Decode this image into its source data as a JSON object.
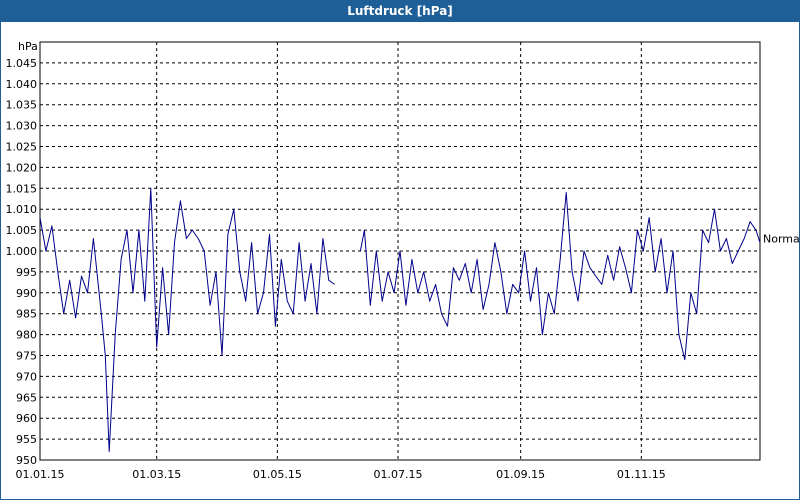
{
  "window": {
    "title": "Luftdruck [hPa]"
  },
  "chart_data": {
    "type": "line",
    "title": "Luftdruck [hPa]",
    "ylabel": "hPa",
    "ylim": [
      950,
      1050
    ],
    "y_ticks": [
      950,
      955,
      960,
      965,
      970,
      975,
      980,
      985,
      990,
      995,
      1000,
      1005,
      1010,
      1015,
      1020,
      1025,
      1030,
      1035,
      1040,
      1045
    ],
    "y_tick_labels": [
      "950",
      "955",
      "960",
      "965",
      "970",
      "975",
      "980",
      "985",
      "990",
      "995",
      "1.000",
      "1.005",
      "1.010",
      "1.015",
      "1.020",
      "1.025",
      "1.030",
      "1.035",
      "1.040",
      "1.045"
    ],
    "x_range": [
      "2015-01-01",
      "2015-12-31"
    ],
    "x_ticks": [
      "2015-01-01",
      "2015-03-01",
      "2015-05-01",
      "2015-07-01",
      "2015-09-01",
      "2015-11-01"
    ],
    "x_tick_labels": [
      "01.01.15",
      "01.03.15",
      "01.05.15",
      "01.07.15",
      "01.09.15",
      "01.11.15"
    ],
    "grid": true,
    "reference_label": "Normal",
    "reference_value": 1003,
    "colors": {
      "line": "#00008b",
      "grid": "#000000",
      "title_bar": "#1f5f98"
    },
    "series": [
      {
        "x": [
          "2015-01-01",
          "2015-01-04",
          "2015-01-07",
          "2015-01-10",
          "2015-01-13",
          "2015-01-16",
          "2015-01-19",
          "2015-01-22",
          "2015-01-25",
          "2015-01-28",
          "2015-02-01",
          "2015-02-03",
          "2015-02-05",
          "2015-02-08",
          "2015-02-11",
          "2015-02-14",
          "2015-02-17",
          "2015-02-20",
          "2015-02-23",
          "2015-02-26",
          "2015-03-01",
          "2015-03-04",
          "2015-03-07",
          "2015-03-10",
          "2015-03-13",
          "2015-03-16",
          "2015-03-19",
          "2015-03-22",
          "2015-03-25",
          "2015-03-28",
          "2015-03-31",
          "2015-04-03",
          "2015-04-06",
          "2015-04-09",
          "2015-04-12",
          "2015-04-15",
          "2015-04-18",
          "2015-04-21",
          "2015-04-24",
          "2015-04-27",
          "2015-04-30",
          "2015-05-03",
          "2015-05-06",
          "2015-05-09",
          "2015-05-12",
          "2015-05-15",
          "2015-05-18",
          "2015-05-21",
          "2015-05-24",
          "2015-05-27",
          "2015-05-30",
          "2015-06-01"
        ],
        "y": [
          1008,
          1000,
          1006,
          995,
          985,
          993,
          984,
          994,
          990,
          1003,
          985,
          975,
          952,
          980,
          998,
          1005,
          990,
          1005,
          988,
          1015,
          977,
          996,
          980,
          1002,
          1012,
          1003,
          1005,
          1003,
          1000,
          987,
          995,
          975,
          1004,
          1010,
          995,
          988,
          1002,
          985,
          990,
          1004,
          982,
          998,
          988,
          985,
          1002,
          988,
          997,
          985,
          1003,
          993,
          992,
          null
        ]
      },
      {
        "x": [
          "2015-06-12",
          "2015-06-14",
          "2015-06-17",
          "2015-06-20",
          "2015-06-23",
          "2015-06-26",
          "2015-06-29",
          "2015-07-02",
          "2015-07-05",
          "2015-07-08",
          "2015-07-11",
          "2015-07-14",
          "2015-07-17",
          "2015-07-20",
          "2015-07-23",
          "2015-07-26",
          "2015-07-29",
          "2015-08-01",
          "2015-08-04",
          "2015-08-07",
          "2015-08-10",
          "2015-08-13",
          "2015-08-16",
          "2015-08-19",
          "2015-08-22",
          "2015-08-25",
          "2015-08-28",
          "2015-08-31",
          "2015-09-03",
          "2015-09-06",
          "2015-09-09",
          "2015-09-12",
          "2015-09-15",
          "2015-09-18",
          "2015-09-21",
          "2015-09-24",
          "2015-09-27",
          "2015-09-30",
          "2015-10-03",
          "2015-10-06",
          "2015-10-09",
          "2015-10-12",
          "2015-10-15",
          "2015-10-18",
          "2015-10-21",
          "2015-10-24",
          "2015-10-27",
          "2015-10-30",
          "2015-11-02",
          "2015-11-05",
          "2015-11-08",
          "2015-11-11",
          "2015-11-14",
          "2015-11-17",
          "2015-11-20",
          "2015-11-23",
          "2015-11-26",
          "2015-11-29",
          "2015-12-02",
          "2015-12-05",
          "2015-12-08",
          "2015-12-11",
          "2015-12-14",
          "2015-12-17",
          "2015-12-20",
          "2015-12-23",
          "2015-12-26",
          "2015-12-29",
          "2015-12-31"
        ],
        "y": [
          1000,
          1005,
          987,
          1000,
          988,
          995,
          990,
          1000,
          987,
          998,
          990,
          995,
          988,
          992,
          985,
          982,
          996,
          993,
          997,
          990,
          998,
          986,
          992,
          1002,
          995,
          985,
          992,
          990,
          1000,
          988,
          996,
          980,
          990,
          985,
          998,
          1014,
          995,
          988,
          1000,
          996,
          994,
          992,
          999,
          993,
          1001,
          996,
          990,
          1005,
          1000,
          1008,
          995,
          1003,
          990,
          1000,
          980,
          974,
          990,
          985,
          1005,
          1002,
          1010,
          1000,
          1003,
          997,
          1000,
          1003,
          1007,
          1005,
          1002
        ]
      }
    ]
  }
}
